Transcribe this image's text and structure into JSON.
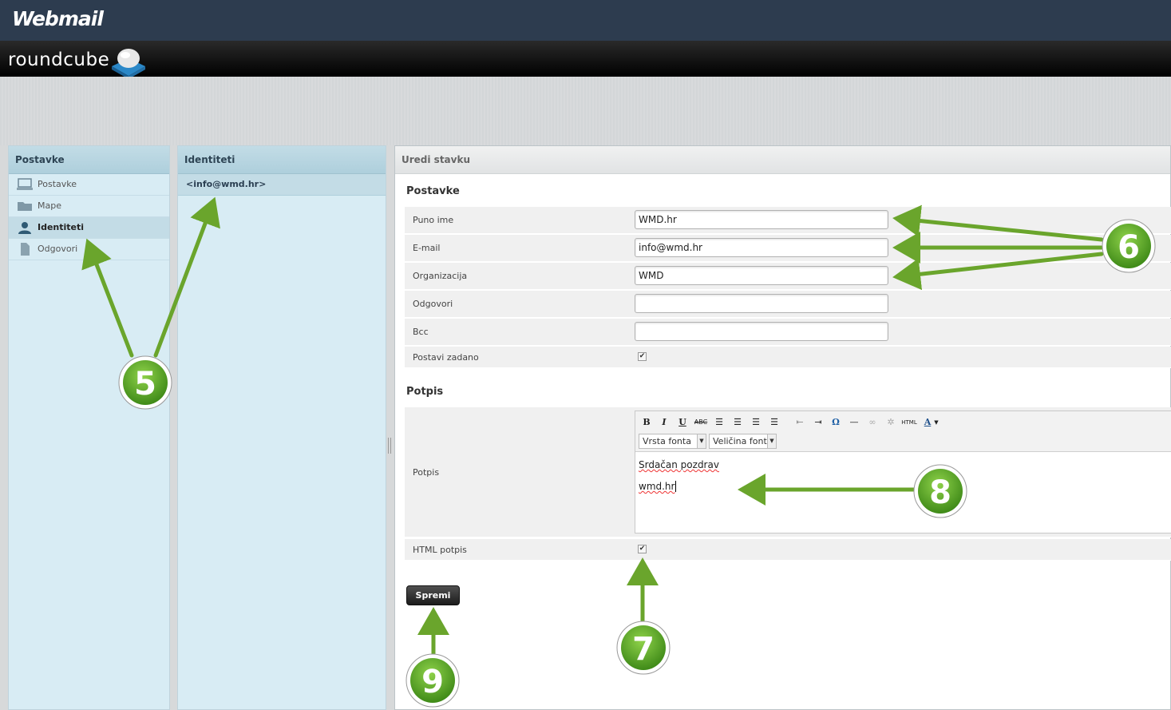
{
  "topbar": {
    "brand": "Webmail"
  },
  "header": {
    "logo_text": "roundcube"
  },
  "settings_nav": {
    "title": "Postavke",
    "items": [
      {
        "label": "Postavke",
        "icon": "computer-icon"
      },
      {
        "label": "Mape",
        "icon": "folder-icon"
      },
      {
        "label": "Identiteti",
        "icon": "user-icon",
        "selected": true
      },
      {
        "label": "Odgovori",
        "icon": "document-icon"
      }
    ]
  },
  "identities": {
    "title": "Identiteti",
    "items": [
      "<info@wmd.hr>"
    ]
  },
  "editor": {
    "title": "Uredi stavku",
    "section_settings": "Postavke",
    "fields": [
      {
        "label": "Puno ime",
        "value": "WMD.hr"
      },
      {
        "label": "E-mail",
        "value": "info@wmd.hr"
      },
      {
        "label": "Organizacija",
        "value": "WMD"
      },
      {
        "label": "Odgovori",
        "value": ""
      },
      {
        "label": "Bcc",
        "value": ""
      }
    ],
    "default_label": "Postavi zadano",
    "default_checked": true,
    "section_signature": "Potpis",
    "signature_label": "Potpis",
    "font_family_select": "Vrsta fonta",
    "font_size_select": "Veličina fonta",
    "signature_lines": [
      "Srdačan pozdrav",
      "wmd.hr"
    ],
    "html_signature_label": "HTML potpis",
    "html_signature_checked": true,
    "save_label": "Spremi"
  },
  "annotations": {
    "badges": [
      "5",
      "6",
      "7",
      "8",
      "9"
    ],
    "arrow_color": "#6aa52c"
  }
}
